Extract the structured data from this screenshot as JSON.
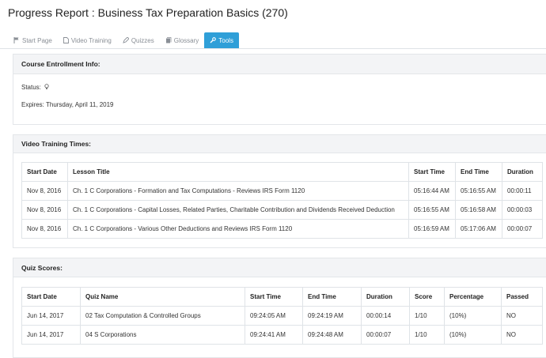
{
  "header": {
    "title": "Progress Report : Business Tax Preparation Basics (270)"
  },
  "tabs": [
    {
      "label": "Start Page",
      "icon": "flag-icon",
      "active": false
    },
    {
      "label": "Video Training",
      "icon": "file-icon",
      "active": false
    },
    {
      "label": "Quizzes",
      "icon": "pencil-icon",
      "active": false
    },
    {
      "label": "Glossary",
      "icon": "book-icon",
      "active": false
    },
    {
      "label": "Tools",
      "icon": "wrench-icon",
      "active": true
    }
  ],
  "enrollment": {
    "heading": "Course Entrollment Info:",
    "status_label": "Status:",
    "expires_label": "Expires: Thursday, April 11, 2019"
  },
  "video": {
    "heading": "Video Training Times:",
    "columns": [
      "Start Date",
      "Lesson Title",
      "Start Time",
      "End Time",
      "Duration"
    ],
    "rows": [
      [
        "Nov 8, 2016",
        "Ch. 1 C Corporations - Formation and Tax Computations - Reviews IRS Form 1120",
        "05:16:44 AM",
        "05:16:55 AM",
        "00:00:11"
      ],
      [
        "Nov 8, 2016",
        "Ch. 1 C Corporations - Capital Losses, Related Parties, Charitable Contribution and Dividends Received Deduction",
        "05:16:55 AM",
        "05:16:58 AM",
        "00:00:03"
      ],
      [
        "Nov 8, 2016",
        "Ch. 1 C Corporations - Various Other Deductions and Reviews IRS Form 1120",
        "05:16:59 AM",
        "05:17:06 AM",
        "00:00:07"
      ]
    ]
  },
  "quiz": {
    "heading": "Quiz Scores:",
    "columns": [
      "Start Date",
      "Quiz Name",
      "Start Time",
      "End Time",
      "Duration",
      "Score",
      "Percentage",
      "Passed"
    ],
    "rows": [
      [
        "Jun 14, 2017",
        "02 Tax Computation & Controlled Groups",
        "09:24:05 AM",
        "09:24:19 AM",
        "00:00:14",
        "1/10",
        "(10%)",
        "NO"
      ],
      [
        "Jun 14, 2017",
        "04 S Corporations",
        "09:24:41 AM",
        "09:24:48 AM",
        "00:00:07",
        "1/10",
        "(10%)",
        "NO"
      ]
    ]
  }
}
